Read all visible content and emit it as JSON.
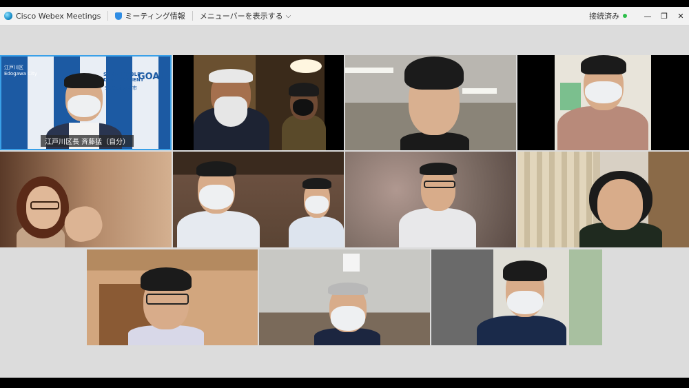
{
  "app": {
    "name": "Cisco Webex Meetings",
    "meeting_info_label": "ミーティング情報",
    "menubar_label": "メニューバーを表示する",
    "status_label": "接続済み",
    "window_controls": {
      "minimize": "—",
      "restore": "❐",
      "close": "✕"
    }
  },
  "self_tile": {
    "name_label": "江戸川区長 斉藤猛（自分）",
    "backdrop_texts": [
      "江戸川区",
      "Edogawa City",
      "SUSTAINABLE",
      "DEVELOPMENT",
      "GOALS",
      "SDGs未来都市",
      "江戸川区"
    ]
  },
  "colors": {
    "accent_blue": "#1c5aa3",
    "status_green": "#2cbf4a",
    "stage_bg": "#dcdcdc"
  }
}
